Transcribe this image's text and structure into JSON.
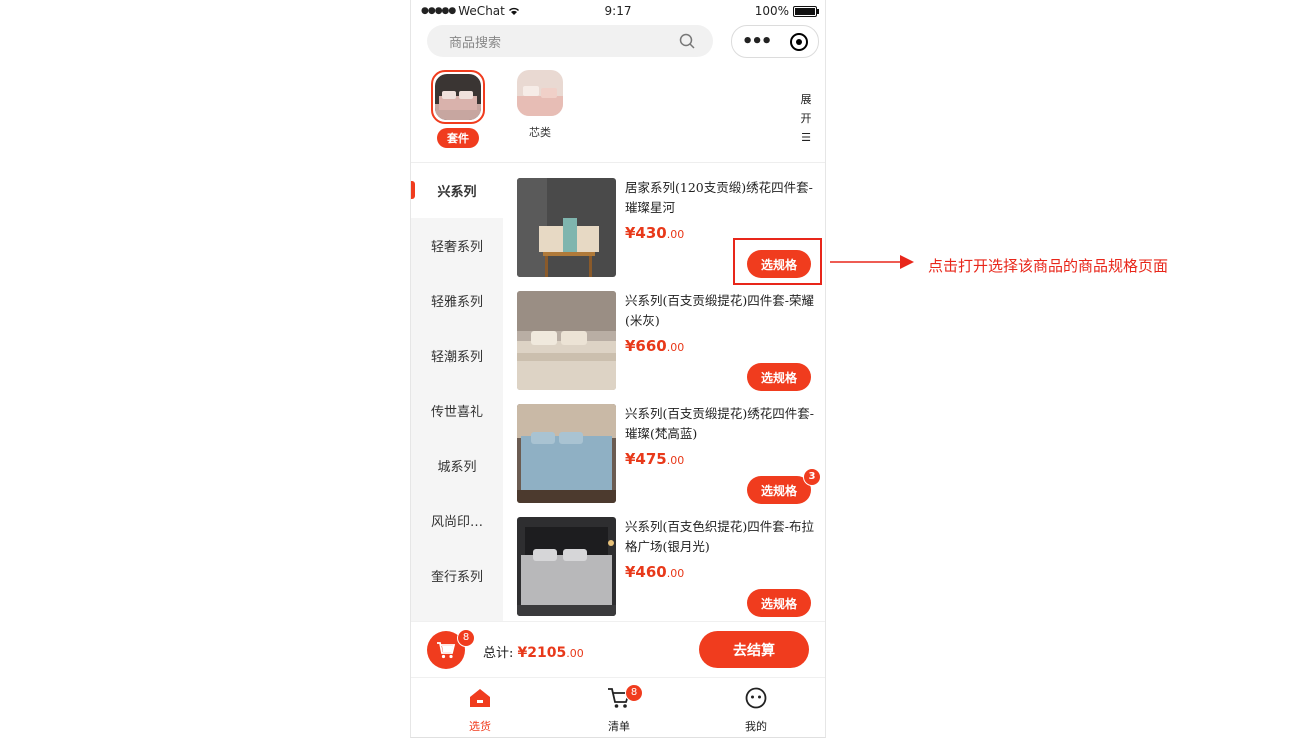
{
  "colors": {
    "accent": "#f03c1e",
    "price": "#e8391a",
    "annotation": "#e8261a"
  },
  "status_bar": {
    "carrier": "WeChat",
    "time": "9:17",
    "battery": "100%"
  },
  "search": {
    "placeholder": "商品搜索",
    "icon": "search-icon"
  },
  "capsule": {
    "more_icon": "more-dots-icon",
    "close_icon": "target-icon"
  },
  "categories": [
    {
      "label": "套件",
      "active": true
    },
    {
      "label": "芯类",
      "active": false
    }
  ],
  "expand": {
    "chars": [
      "展",
      "开",
      "☰"
    ]
  },
  "sidebar": {
    "items": [
      {
        "label": "兴系列",
        "active": true
      },
      {
        "label": "轻奢系列",
        "active": false
      },
      {
        "label": "轻雅系列",
        "active": false
      },
      {
        "label": "轻潮系列",
        "active": false
      },
      {
        "label": "传世喜礼",
        "active": false
      },
      {
        "label": "城系列",
        "active": false
      },
      {
        "label": "风尚印…",
        "active": false
      },
      {
        "label": "奎行系列",
        "active": false
      }
    ]
  },
  "products": [
    {
      "name": "居家系列(120支贡缎)绣花四件套-璀璨星河",
      "price_int": "¥430",
      "price_dec": ".00",
      "button": "选规格",
      "badge": ""
    },
    {
      "name": "兴系列(百支贡缎提花)四件套-荣耀(米灰)",
      "price_int": "¥660",
      "price_dec": ".00",
      "button": "选规格",
      "badge": ""
    },
    {
      "name": "兴系列(百支贡缎提花)绣花四件套-璀璨(梵高蓝)",
      "price_int": "¥475",
      "price_dec": ".00",
      "button": "选规格",
      "badge": "3"
    },
    {
      "name": "兴系列(百支色织提花)四件套-布拉格广场(银月光)",
      "price_int": "¥460",
      "price_dec": ".00",
      "button": "选规格",
      "badge": ""
    }
  ],
  "cart": {
    "badge": "8",
    "total_label": "总计:",
    "total_int": "¥2105",
    "total_dec": ".00",
    "checkout": "去结算"
  },
  "tabs": [
    {
      "label": "选货",
      "icon": "home-icon",
      "active": true,
      "badge": ""
    },
    {
      "label": "清单",
      "icon": "cart-icon",
      "active": false,
      "badge": "8"
    },
    {
      "label": "我的",
      "icon": "smile-face-icon",
      "active": false,
      "badge": ""
    }
  ],
  "annotation": {
    "text": "点击打开选择该商品的商品规格页面"
  }
}
